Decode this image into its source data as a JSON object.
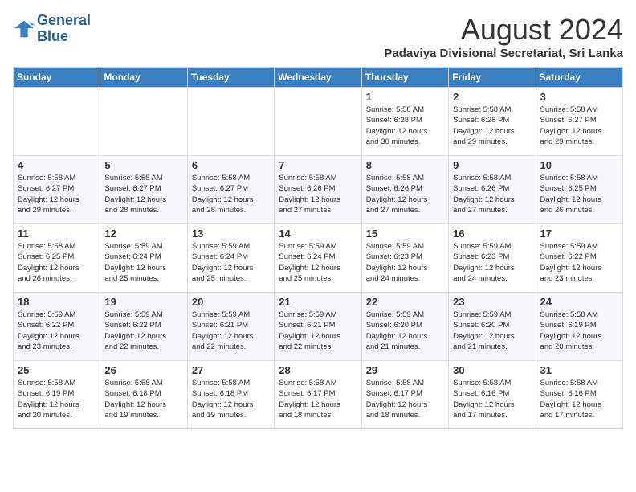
{
  "logo": {
    "line1": "General",
    "line2": "Blue"
  },
  "calendar": {
    "title": "August 2024",
    "subtitle": "Padaviya Divisional Secretariat, Sri Lanka"
  },
  "headers": [
    "Sunday",
    "Monday",
    "Tuesday",
    "Wednesday",
    "Thursday",
    "Friday",
    "Saturday"
  ],
  "weeks": [
    [
      {
        "day": "",
        "info": ""
      },
      {
        "day": "",
        "info": ""
      },
      {
        "day": "",
        "info": ""
      },
      {
        "day": "",
        "info": ""
      },
      {
        "day": "1",
        "info": "Sunrise: 5:58 AM\nSunset: 6:28 PM\nDaylight: 12 hours\nand 30 minutes."
      },
      {
        "day": "2",
        "info": "Sunrise: 5:58 AM\nSunset: 6:28 PM\nDaylight: 12 hours\nand 29 minutes."
      },
      {
        "day": "3",
        "info": "Sunrise: 5:58 AM\nSunset: 6:27 PM\nDaylight: 12 hours\nand 29 minutes."
      }
    ],
    [
      {
        "day": "4",
        "info": "Sunrise: 5:58 AM\nSunset: 6:27 PM\nDaylight: 12 hours\nand 29 minutes."
      },
      {
        "day": "5",
        "info": "Sunrise: 5:58 AM\nSunset: 6:27 PM\nDaylight: 12 hours\nand 28 minutes."
      },
      {
        "day": "6",
        "info": "Sunrise: 5:58 AM\nSunset: 6:27 PM\nDaylight: 12 hours\nand 28 minutes."
      },
      {
        "day": "7",
        "info": "Sunrise: 5:58 AM\nSunset: 6:26 PM\nDaylight: 12 hours\nand 27 minutes."
      },
      {
        "day": "8",
        "info": "Sunrise: 5:58 AM\nSunset: 6:26 PM\nDaylight: 12 hours\nand 27 minutes."
      },
      {
        "day": "9",
        "info": "Sunrise: 5:58 AM\nSunset: 6:26 PM\nDaylight: 12 hours\nand 27 minutes."
      },
      {
        "day": "10",
        "info": "Sunrise: 5:58 AM\nSunset: 6:25 PM\nDaylight: 12 hours\nand 26 minutes."
      }
    ],
    [
      {
        "day": "11",
        "info": "Sunrise: 5:58 AM\nSunset: 6:25 PM\nDaylight: 12 hours\nand 26 minutes."
      },
      {
        "day": "12",
        "info": "Sunrise: 5:59 AM\nSunset: 6:24 PM\nDaylight: 12 hours\nand 25 minutes."
      },
      {
        "day": "13",
        "info": "Sunrise: 5:59 AM\nSunset: 6:24 PM\nDaylight: 12 hours\nand 25 minutes."
      },
      {
        "day": "14",
        "info": "Sunrise: 5:59 AM\nSunset: 6:24 PM\nDaylight: 12 hours\nand 25 minutes."
      },
      {
        "day": "15",
        "info": "Sunrise: 5:59 AM\nSunset: 6:23 PM\nDaylight: 12 hours\nand 24 minutes."
      },
      {
        "day": "16",
        "info": "Sunrise: 5:59 AM\nSunset: 6:23 PM\nDaylight: 12 hours\nand 24 minutes."
      },
      {
        "day": "17",
        "info": "Sunrise: 5:59 AM\nSunset: 6:22 PM\nDaylight: 12 hours\nand 23 minutes."
      }
    ],
    [
      {
        "day": "18",
        "info": "Sunrise: 5:59 AM\nSunset: 6:22 PM\nDaylight: 12 hours\nand 23 minutes."
      },
      {
        "day": "19",
        "info": "Sunrise: 5:59 AM\nSunset: 6:22 PM\nDaylight: 12 hours\nand 22 minutes."
      },
      {
        "day": "20",
        "info": "Sunrise: 5:59 AM\nSunset: 6:21 PM\nDaylight: 12 hours\nand 22 minutes."
      },
      {
        "day": "21",
        "info": "Sunrise: 5:59 AM\nSunset: 6:21 PM\nDaylight: 12 hours\nand 22 minutes."
      },
      {
        "day": "22",
        "info": "Sunrise: 5:59 AM\nSunset: 6:20 PM\nDaylight: 12 hours\nand 21 minutes."
      },
      {
        "day": "23",
        "info": "Sunrise: 5:59 AM\nSunset: 6:20 PM\nDaylight: 12 hours\nand 21 minutes."
      },
      {
        "day": "24",
        "info": "Sunrise: 5:58 AM\nSunset: 6:19 PM\nDaylight: 12 hours\nand 20 minutes."
      }
    ],
    [
      {
        "day": "25",
        "info": "Sunrise: 5:58 AM\nSunset: 6:19 PM\nDaylight: 12 hours\nand 20 minutes."
      },
      {
        "day": "26",
        "info": "Sunrise: 5:58 AM\nSunset: 6:18 PM\nDaylight: 12 hours\nand 19 minutes."
      },
      {
        "day": "27",
        "info": "Sunrise: 5:58 AM\nSunset: 6:18 PM\nDaylight: 12 hours\nand 19 minutes."
      },
      {
        "day": "28",
        "info": "Sunrise: 5:58 AM\nSunset: 6:17 PM\nDaylight: 12 hours\nand 18 minutes."
      },
      {
        "day": "29",
        "info": "Sunrise: 5:58 AM\nSunset: 6:17 PM\nDaylight: 12 hours\nand 18 minutes."
      },
      {
        "day": "30",
        "info": "Sunrise: 5:58 AM\nSunset: 6:16 PM\nDaylight: 12 hours\nand 17 minutes."
      },
      {
        "day": "31",
        "info": "Sunrise: 5:58 AM\nSunset: 6:16 PM\nDaylight: 12 hours\nand 17 minutes."
      }
    ]
  ]
}
